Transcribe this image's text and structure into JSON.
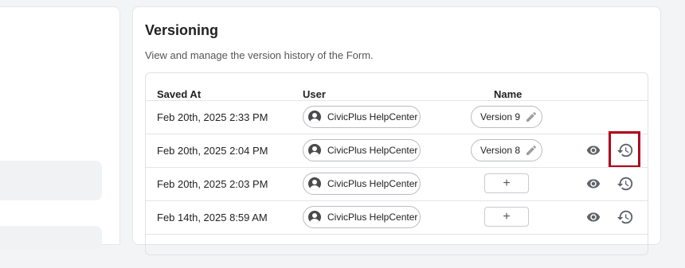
{
  "section": {
    "title": "Versioning",
    "subtitle": "View and manage the version history of the Form."
  },
  "table": {
    "headers": {
      "saved_at": "Saved At",
      "user": "User",
      "name": "Name"
    },
    "rows": [
      {
        "saved_at": "Feb 20th, 2025 2:33 PM",
        "user": "CivicPlus HelpCenter",
        "name": "Version 9",
        "actions": false
      },
      {
        "saved_at": "Feb 20th, 2025 2:04 PM",
        "user": "CivicPlus HelpCenter",
        "name": "Version 8",
        "actions": true,
        "highlighted": true
      },
      {
        "saved_at": "Feb 20th, 2025 2:03 PM",
        "user": "CivicPlus HelpCenter",
        "name": "",
        "add_symbol": "+",
        "actions": true
      },
      {
        "saved_at": "Feb 14th, 2025 8:59 AM",
        "user": "CivicPlus HelpCenter",
        "name": "",
        "add_symbol": "+",
        "actions": true
      }
    ]
  },
  "icons": {
    "avatar": "user-avatar-icon",
    "edit": "pencil-icon",
    "view": "eye-icon",
    "restore": "restore-history-icon"
  },
  "colors": {
    "highlight": "#b3001b",
    "icon_gray": "#5f6368",
    "pencil_gray": "#9e9e9e"
  }
}
